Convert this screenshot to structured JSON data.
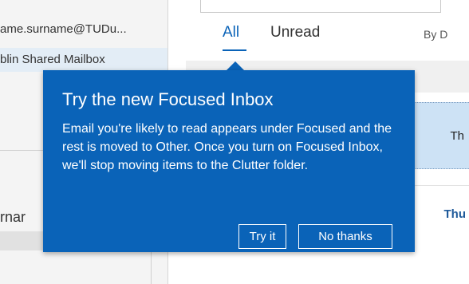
{
  "folder_pane": {
    "account_email": "ame.surname@TUDu...",
    "shared_mailbox": "blin Shared Mailbox",
    "cut_label": "rnar"
  },
  "message_list": {
    "tabs": [
      {
        "label": "All",
        "active": true
      },
      {
        "label": "Unread",
        "active": false
      }
    ],
    "sort_label": "By D",
    "selected_row_snippet": "Th",
    "unread_row_snippet": "Thu"
  },
  "callout": {
    "title": "Try the new Focused Inbox",
    "body": "Email you're likely to read appears under Focused and the rest is moved to Other. Once you turn on Focused Inbox, we'll stop moving items to the Clutter folder.",
    "try_label": "Try it",
    "no_thanks_label": "No thanks"
  },
  "colors": {
    "accent": "#0a63b8",
    "selected_row": "#cde2f5"
  }
}
